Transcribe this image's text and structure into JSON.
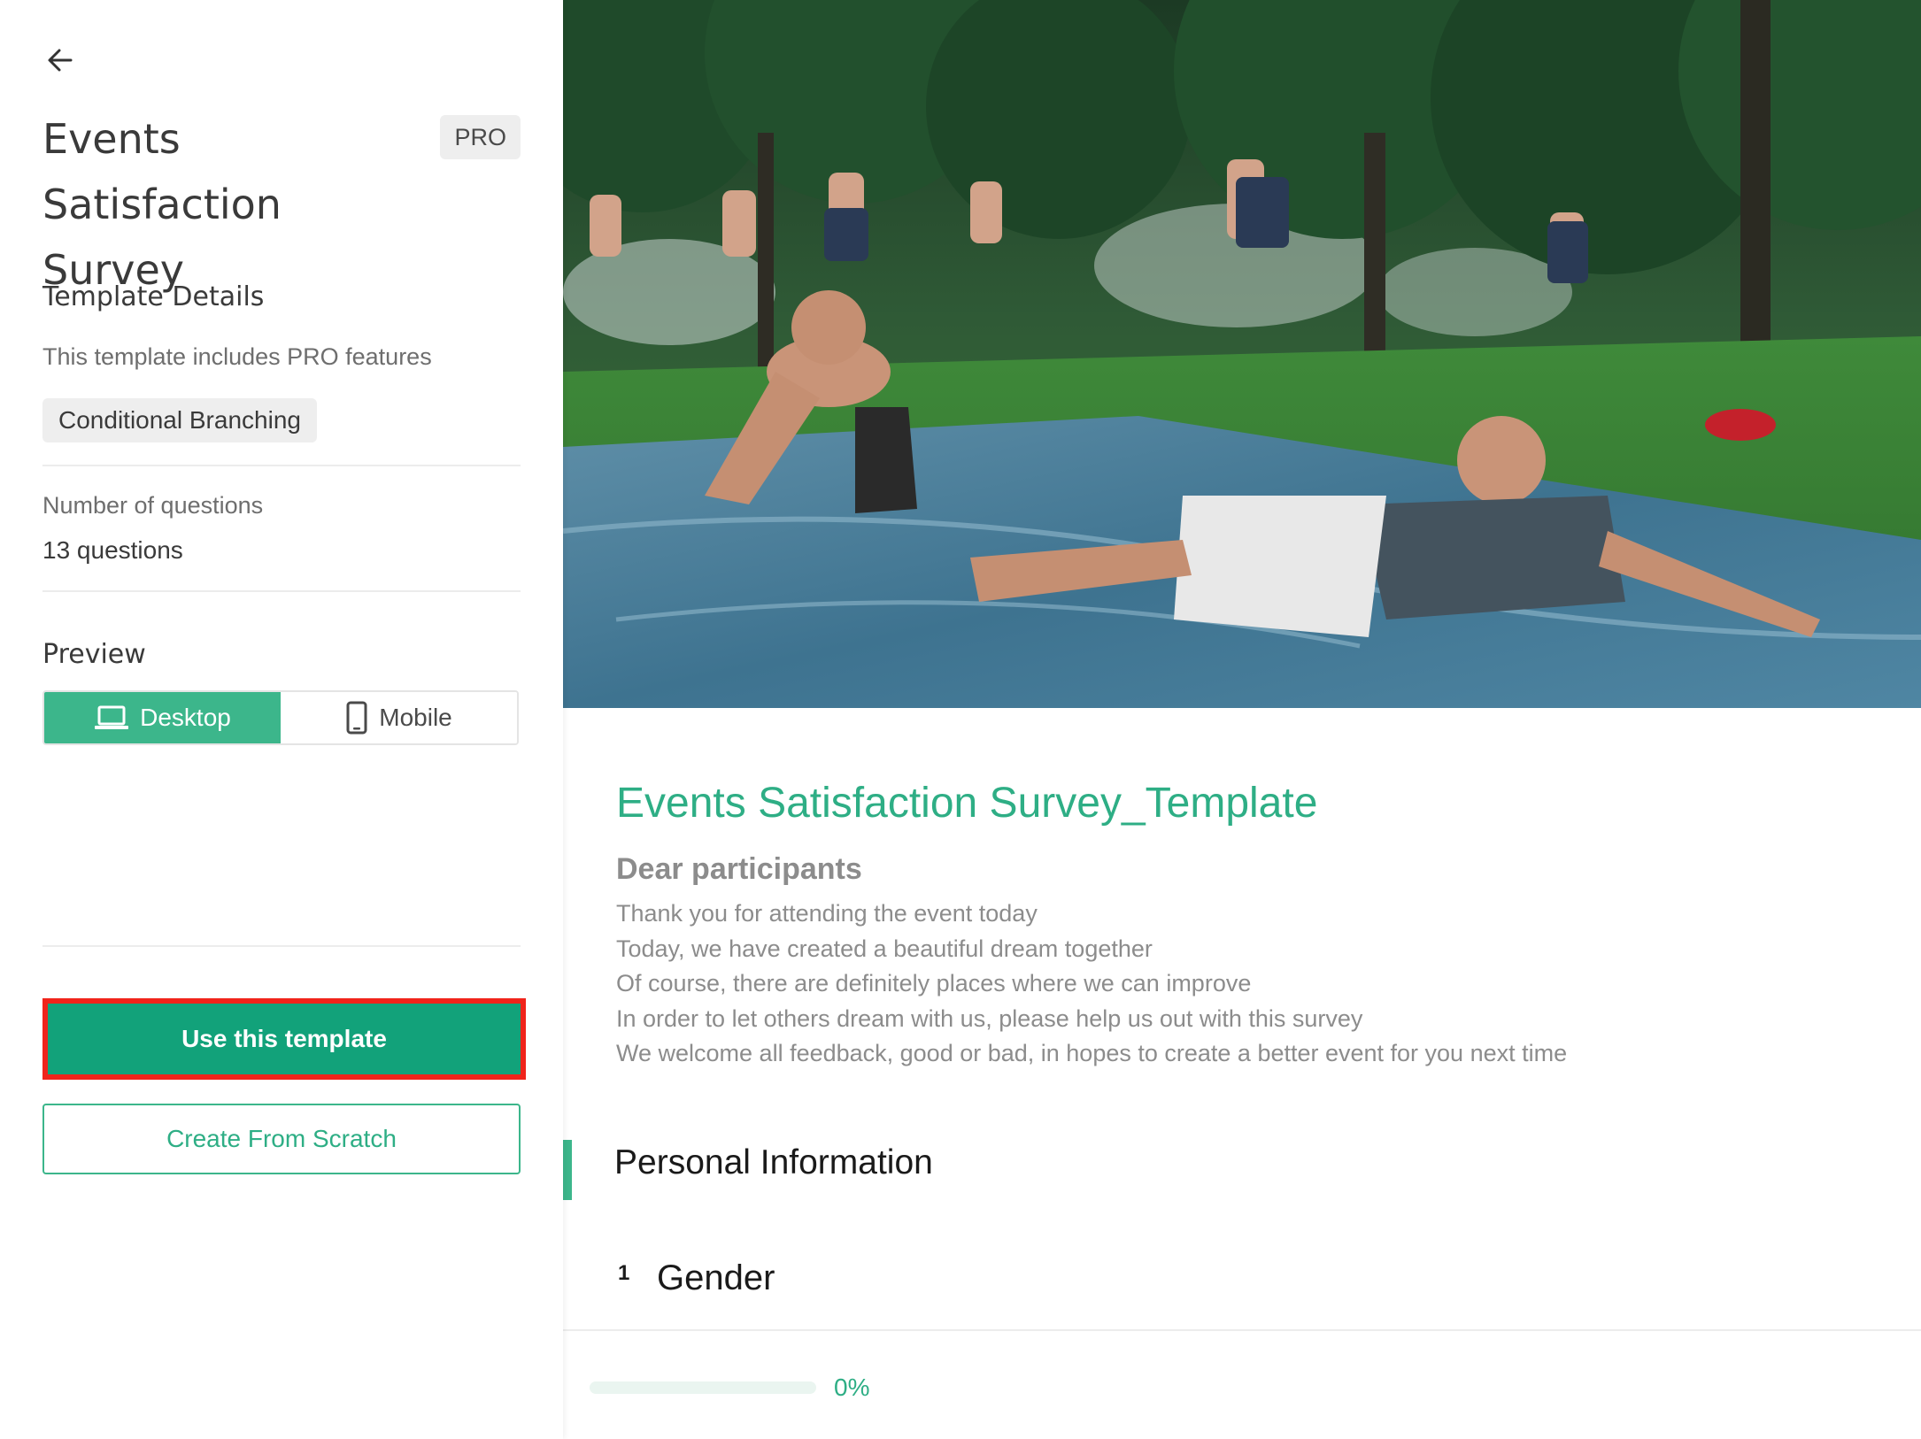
{
  "sidebar": {
    "title": "Events Satisfaction Survey",
    "badge": "PRO",
    "details_heading": "Template Details",
    "pro_note": "This template includes PRO features",
    "feature_chip": "Conditional Branching",
    "questions_label": "Number of questions",
    "questions_value": "13 questions",
    "preview_heading": "Preview",
    "preview_options": {
      "desktop": "Desktop",
      "mobile": "Mobile",
      "selected": "Desktop"
    },
    "use_template": "Use this template",
    "create_scratch": "Create From Scratch"
  },
  "preview": {
    "form_title": "Events Satisfaction Survey_Template",
    "intro_heading": "Dear participants",
    "intro_lines": [
      "Thank you for attending the event today",
      "Today, we have created a beautiful dream together",
      "Of course, there are definitely places where we can improve",
      "In order to let others dream with us, please help us out with this survey",
      "We welcome all feedback, good or bad, in hopes to create a better event for you next time"
    ],
    "section_title": "Personal Information",
    "question_number": "1",
    "question_text": "Gender",
    "progress": {
      "value": 0,
      "label": "0%"
    }
  },
  "colors": {
    "accent": "#3cb68b",
    "primary_button": "#12a27a",
    "highlight_border": "#f0241b"
  },
  "icons": {
    "back": "arrow-left-icon",
    "desktop": "laptop-icon",
    "mobile": "smartphone-icon"
  }
}
